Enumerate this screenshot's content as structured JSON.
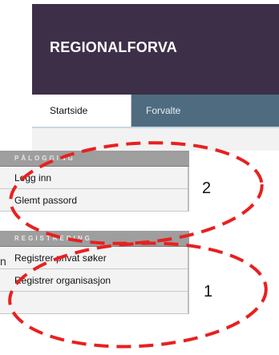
{
  "header": {
    "title": "REGIONALFORVA"
  },
  "tabs": [
    {
      "label": "Startside",
      "active": true
    },
    {
      "label": "Forvalte",
      "active": false
    }
  ],
  "sidebar": {
    "sections": [
      {
        "title": "PÅLOGGING",
        "items": [
          "Logg inn",
          "Glemt passord"
        ]
      },
      {
        "title": "REGISTRERING",
        "items": [
          "Registrer privat søker",
          "Registrer organisasjon",
          ""
        ]
      }
    ]
  },
  "annotations": {
    "markers": [
      "2",
      "1"
    ],
    "edge_glyph": "n",
    "circle_color": "#e8201f"
  },
  "colors": {
    "header_bg": "#3e2f49",
    "tab_inactive_bg": "#4f6b7f",
    "section_header_bg": "#9e9e9e"
  }
}
